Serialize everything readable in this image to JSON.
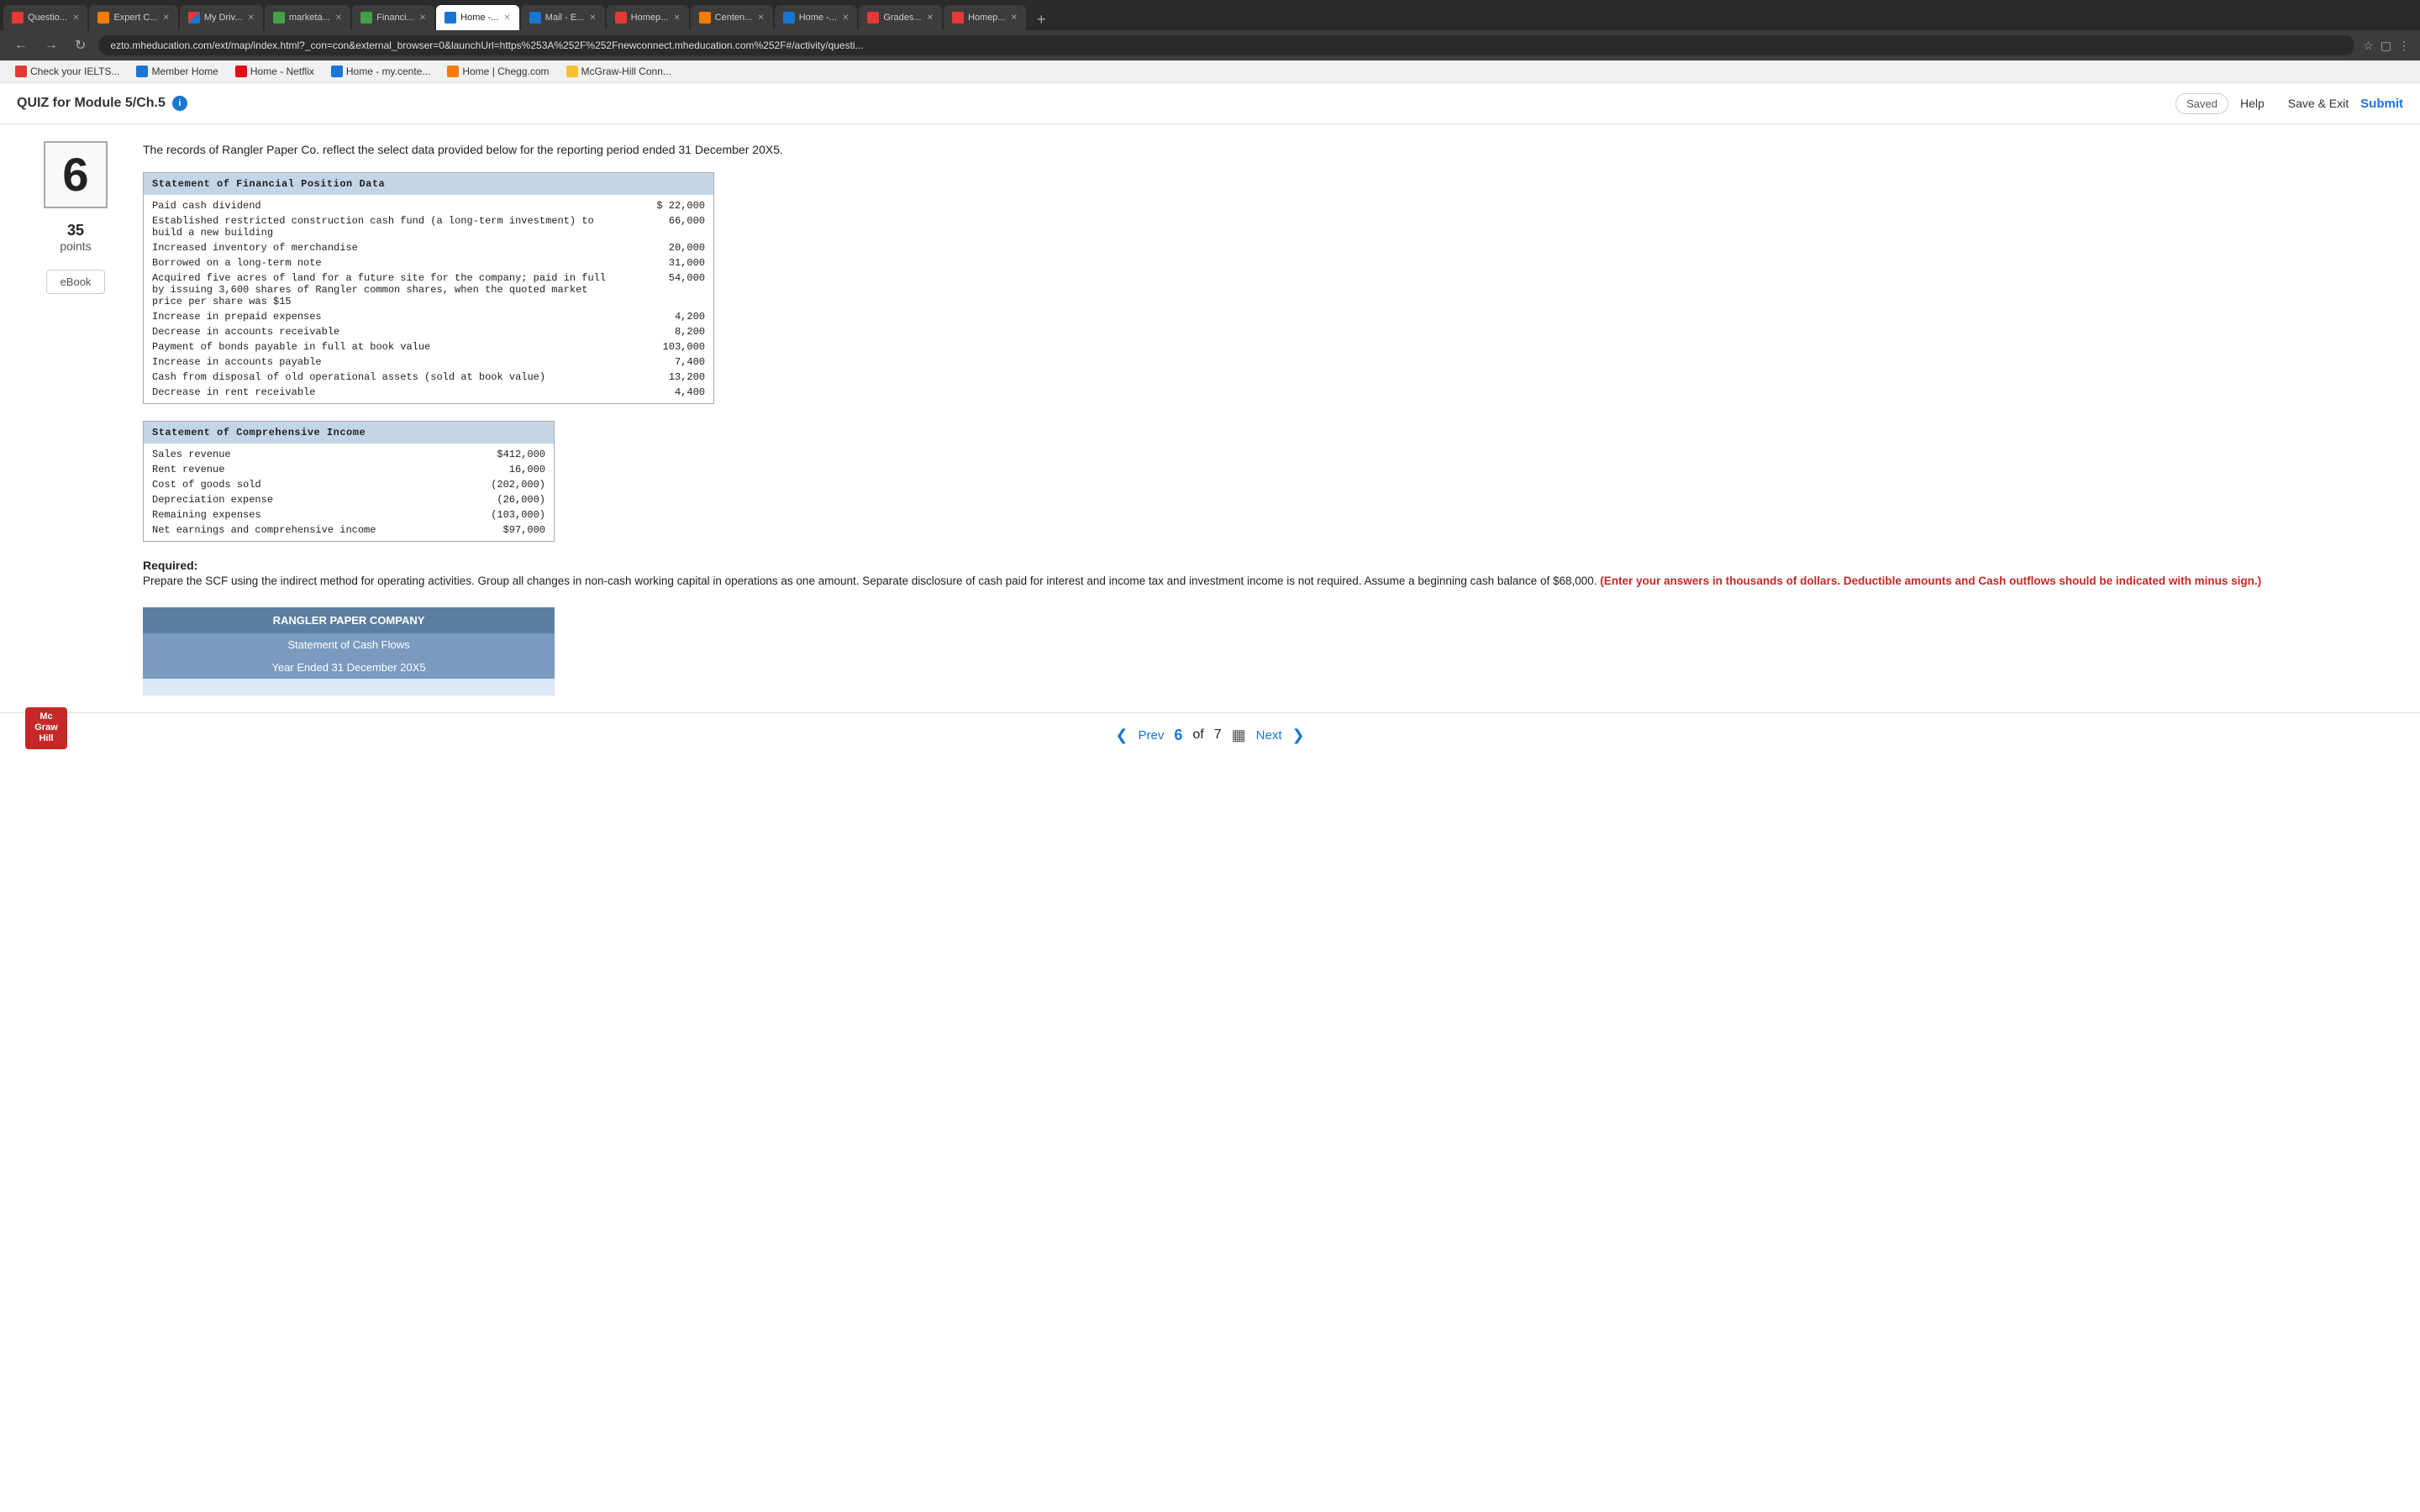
{
  "browser": {
    "tabs": [
      {
        "label": "Questio...",
        "favicon_color": "red",
        "active": false
      },
      {
        "label": "Expert C...",
        "favicon_color": "orange",
        "active": false
      },
      {
        "label": "My Driv...",
        "favicon_color": "multi",
        "active": false
      },
      {
        "label": "marketa...",
        "favicon_color": "green",
        "active": false
      },
      {
        "label": "Financi...",
        "favicon_color": "green",
        "active": false
      },
      {
        "label": "Home -...",
        "favicon_color": "blue",
        "active": true
      },
      {
        "label": "Mail - E...",
        "favicon_color": "blue",
        "active": false
      },
      {
        "label": "Homep...",
        "favicon_color": "red",
        "active": false
      },
      {
        "label": "Centen...",
        "favicon_color": "orange",
        "active": false
      },
      {
        "label": "Home -...",
        "favicon_color": "blue",
        "active": false
      },
      {
        "label": "Grades...",
        "favicon_color": "red",
        "active": false
      },
      {
        "label": "Homep...",
        "favicon_color": "red",
        "active": false
      }
    ],
    "address": "ezto.mheducation.com/ext/map/index.html?_con=con&external_browser=0&launchUrl=https%253A%252F%252Fnewconnect.mheducation.com%252F#/activity/questi...",
    "bookmarks": [
      {
        "label": "Check your IELTS...",
        "color": "red"
      },
      {
        "label": "Member Home",
        "color": "blue"
      },
      {
        "label": "Home - Netflix",
        "color": "netflix"
      },
      {
        "label": "Home - my.cente...",
        "color": "blue"
      },
      {
        "label": "Home | Chegg.com",
        "color": "orange"
      },
      {
        "label": "McGraw-Hill Conn...",
        "color": "yellow"
      }
    ]
  },
  "header": {
    "quiz_title": "QUIZ for Module 5/Ch.5",
    "saved_label": "Saved",
    "help_label": "Help",
    "save_exit_label": "Save & Exit",
    "submit_label": "Submit"
  },
  "question": {
    "number": "6",
    "points": "35",
    "points_label": "points",
    "ebook_label": "eBook",
    "text": "The records of Rangler Paper Co. reflect the select data provided below for the reporting period ended 31 December 20X5."
  },
  "financial_position": {
    "header": "Statement of Financial Position Data",
    "rows": [
      {
        "label": "Paid cash dividend",
        "value": "$ 22,000"
      },
      {
        "label": "Established restricted construction cash fund (a long-term investment) to build a new building",
        "value": "66,000"
      },
      {
        "label": "Increased inventory of merchandise",
        "value": "20,000"
      },
      {
        "label": "Borrowed on a long-term note",
        "value": "31,000"
      },
      {
        "label": "Acquired five acres of land for a future site for the company; paid in full by issuing 3,600 shares of Rangler common shares, when the quoted market price per share was $15",
        "value": "54,000"
      },
      {
        "label": "Increase in prepaid expenses",
        "value": "4,200"
      },
      {
        "label": "Decrease in accounts receivable",
        "value": "8,200"
      },
      {
        "label": "Payment of bonds payable in full at book value",
        "value": "103,000"
      },
      {
        "label": "Increase in accounts payable",
        "value": "7,400"
      },
      {
        "label": "Cash from disposal of old operational assets (sold at book value)",
        "value": "13,200"
      },
      {
        "label": "Decrease in rent receivable",
        "value": "4,400"
      }
    ]
  },
  "comprehensive_income": {
    "header": "Statement of Comprehensive Income",
    "rows": [
      {
        "label": "Sales revenue",
        "value": "$412,000"
      },
      {
        "label": "Rent revenue",
        "value": "16,000"
      },
      {
        "label": "Cost of goods sold",
        "value": "(202,000)"
      },
      {
        "label": "Depreciation expense",
        "value": "(26,000)"
      },
      {
        "label": "Remaining expenses",
        "value": "(103,000)"
      },
      {
        "label": "Net earnings and comprehensive income",
        "value": "$97,000"
      }
    ]
  },
  "required": {
    "title": "Required:",
    "text": "Prepare the SCF using the indirect method for operating activities. Group all changes in non-cash working capital in operations as one amount. Separate disclosure of cash paid for interest and income tax and investment income is not required. Assume a beginning cash balance of $68,000.",
    "note": "(Enter your answers in thousands of dollars. Deductible amounts and Cash outflows should be indicated with minus sign.)"
  },
  "answer_table": {
    "company": "RANGLER PAPER COMPANY",
    "title": "Statement of Cash Flows",
    "subtitle": "Year Ended 31 December 20X5"
  },
  "footer": {
    "prev_label": "Prev",
    "next_label": "Next",
    "current_page": "6",
    "of_label": "of",
    "total_pages": "7",
    "logo_lines": [
      "Mc",
      "Graw",
      "Hill"
    ]
  }
}
